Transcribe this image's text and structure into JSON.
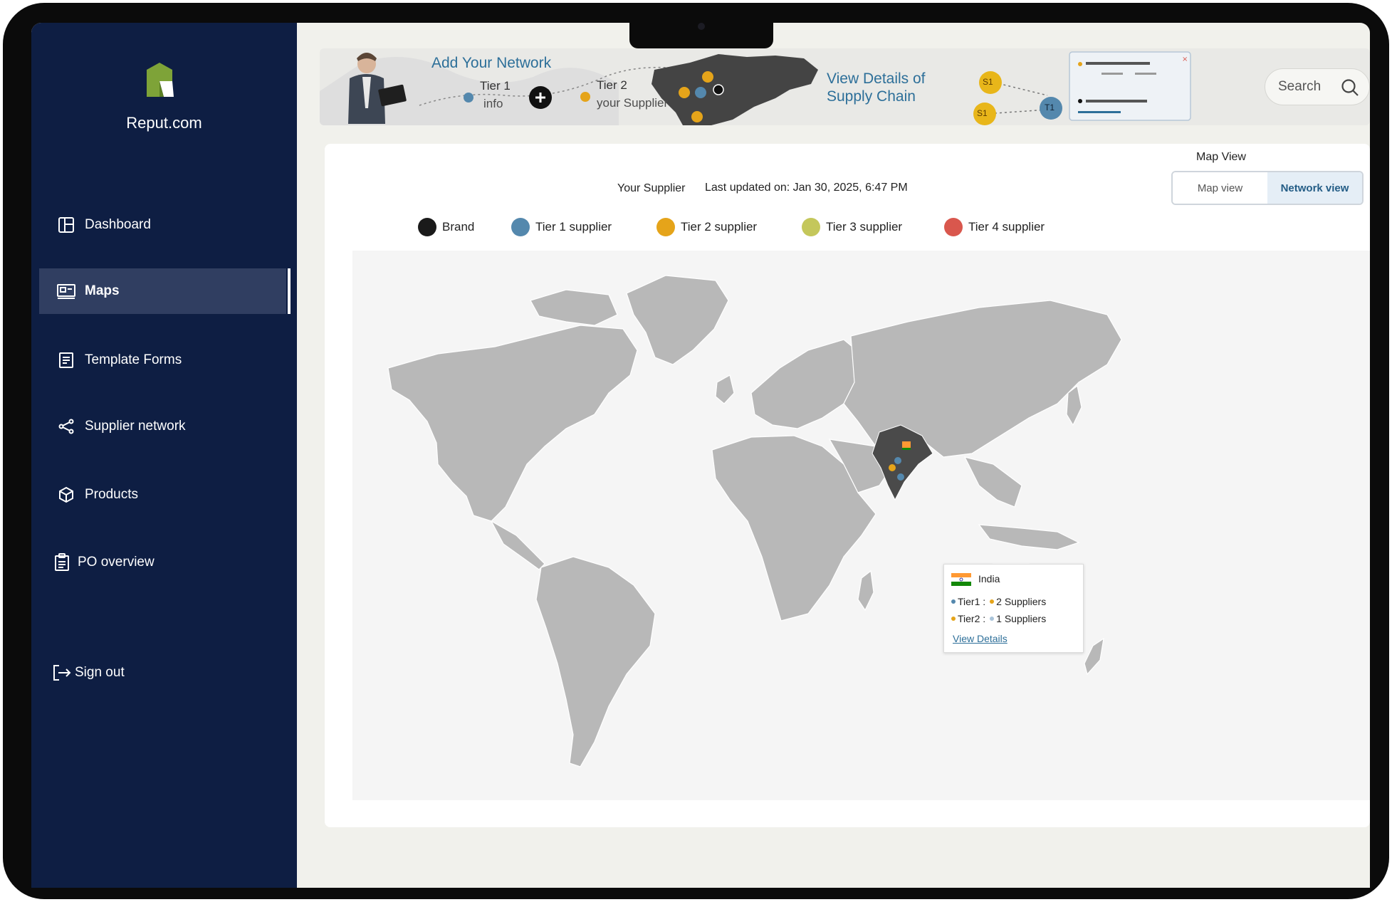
{
  "brand": {
    "name": "Reput.com"
  },
  "sidebar": {
    "items": [
      {
        "label": "Dashboard",
        "icon": "dashboard-icon"
      },
      {
        "label": "Maps",
        "icon": "map-icon",
        "active": true
      },
      {
        "label": "Template Forms",
        "icon": "form-icon"
      },
      {
        "label": "Supplier network",
        "icon": "share-icon"
      },
      {
        "label": "Products",
        "icon": "box-icon"
      },
      {
        "label": "PO overview",
        "icon": "clipboard-icon"
      },
      {
        "label": "Sign out",
        "icon": "signout-icon"
      }
    ]
  },
  "banner": {
    "add_network_title": "Add Your Network",
    "tier1_label": "Tier 1",
    "tier1_sub": "info",
    "tier2_label": "Tier 2",
    "tier2_sub": "your Supplier",
    "view_details_title_line1": "View Details of",
    "view_details_title_line2": "Supply Chain",
    "node_s1": "S1",
    "node_t1": "T1"
  },
  "search": {
    "placeholder": "Search"
  },
  "map_header": {
    "your_supplier": "Your Supplier",
    "last_updated": "Last updated on: Jan 30, 2025, 6:47 PM",
    "map_view_label": "Map View",
    "toggle_map": "Map view",
    "toggle_network": "Network view",
    "active_toggle": "Network view"
  },
  "legend": [
    {
      "label": "Brand",
      "color": "#1a1a1a"
    },
    {
      "label": "Tier 1 supplier",
      "color": "#5488ad"
    },
    {
      "label": "Tier 2 supplier",
      "color": "#e5a41a"
    },
    {
      "label": "Tier 3 supplier",
      "color": "#c4c75b"
    },
    {
      "label": "Tier 4 supplier",
      "color": "#d9574d"
    }
  ],
  "tooltip": {
    "country": "India",
    "tier1_label": "Tier1 :",
    "tier1_value": "2 Suppliers",
    "tier2_label": "Tier2 :",
    "tier2_value": "1 Suppliers",
    "link": "View Details"
  },
  "colors": {
    "sidebar_bg": "#0e1e43",
    "active_item_bg": "#303e61",
    "accent_blue": "#2d6f99",
    "map_land": "#b8b8b8",
    "highlight_country": "#4a4a4a"
  }
}
